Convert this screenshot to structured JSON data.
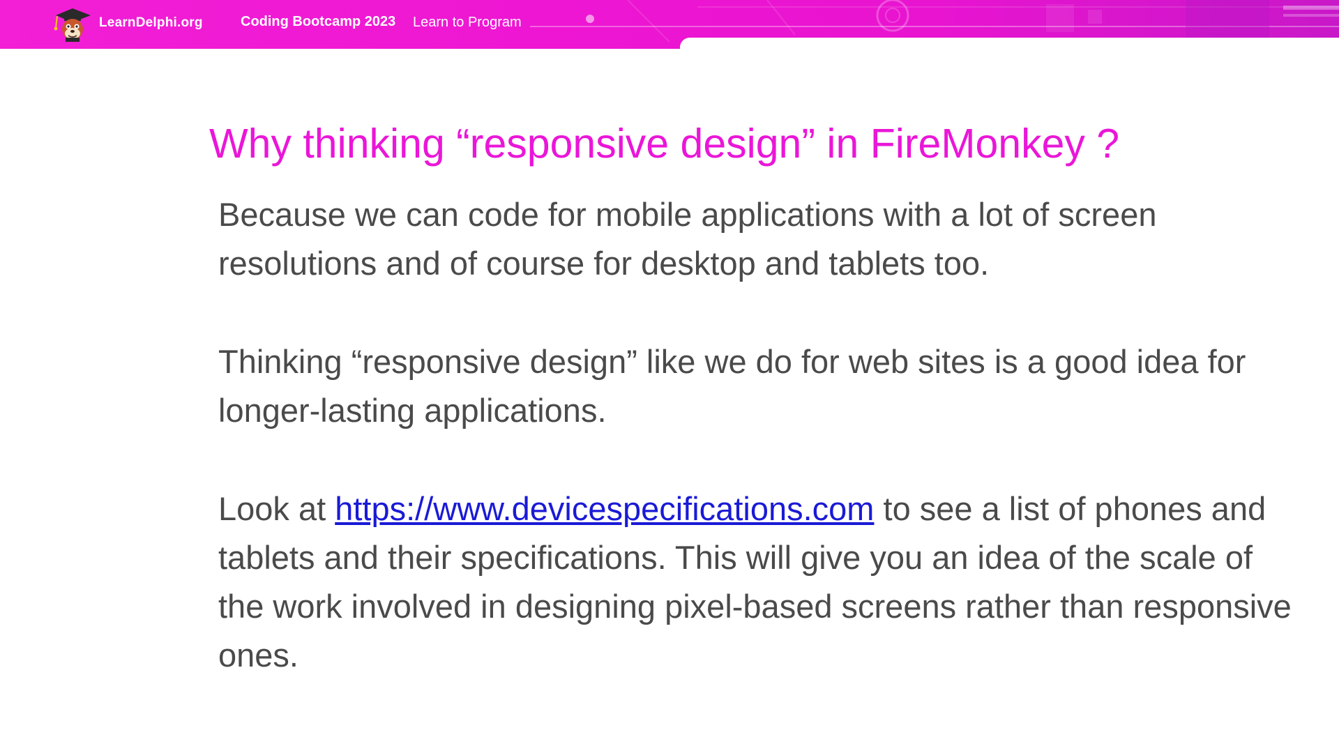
{
  "header": {
    "logo_text": "LearnDelphi.org",
    "bootcamp_title": "Coding Bootcamp 2023",
    "bootcamp_subtitle": "Learn to Program",
    "accent_color": "#f21fd6"
  },
  "slide": {
    "title": "Why thinking “responsive design” in FireMonkey ?",
    "paragraph1": "Because we can code for mobile applications with a lot of screen resolutions and of course for desktop and tablets too.",
    "paragraph2": "Thinking “responsive design” like we do for web sites is a good idea for longer-lasting applications.",
    "paragraph3": {
      "prefix": "Look at ",
      "link_text": "https://www.devicespecifications.com",
      "suffix": " to see a list of phones and tablets and their specifications. This will give you an idea of the scale of the work involved in designing pixel-based screens rather than responsive ones."
    },
    "title_color": "#ea16d8",
    "text_color": "#4a4a4a",
    "link_color": "#1a1ad6"
  }
}
